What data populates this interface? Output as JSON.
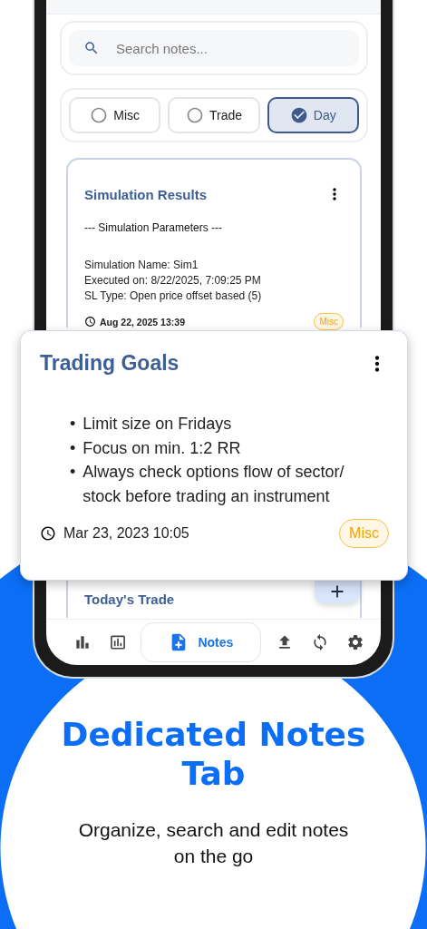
{
  "search": {
    "placeholder": "Search notes..."
  },
  "filters": [
    {
      "label": "Misc",
      "selected": false
    },
    {
      "label": "Trade",
      "selected": false
    },
    {
      "label": "Day",
      "selected": true
    }
  ],
  "notes": [
    {
      "title": "Simulation Results",
      "heading": "--- Simulation Parameters ---",
      "lines": [
        "Simulation Name: Sim1",
        "Executed on: 8/22/2025, 7:09:25 PM",
        "SL Type: Open price offset based (5)"
      ],
      "date": "Aug 22, 2025 13:39",
      "tag": "Misc"
    },
    {
      "title": "Today's Trade"
    }
  ],
  "focused_note": {
    "title": "Trading Goals",
    "marker": "•",
    "bullets": [
      "Limit size on Fridays",
      "Focus on min. 1:2 RR",
      "Always check options flow of sector/ stock before trading an instrument"
    ],
    "date": "Mar 23, 2023 10:05",
    "tag": "Misc"
  },
  "nav": [
    {
      "kind": "stats",
      "selected": false
    },
    {
      "kind": "chart",
      "selected": false
    },
    {
      "kind": "notes",
      "label": "Notes",
      "selected": true
    },
    {
      "kind": "upload",
      "selected": false
    },
    {
      "kind": "sync",
      "selected": false
    },
    {
      "kind": "settings",
      "selected": false
    }
  ],
  "promo": {
    "title": "Dedicated Notes Tab",
    "subtitle": "Organize, search and edit notes on the go"
  }
}
